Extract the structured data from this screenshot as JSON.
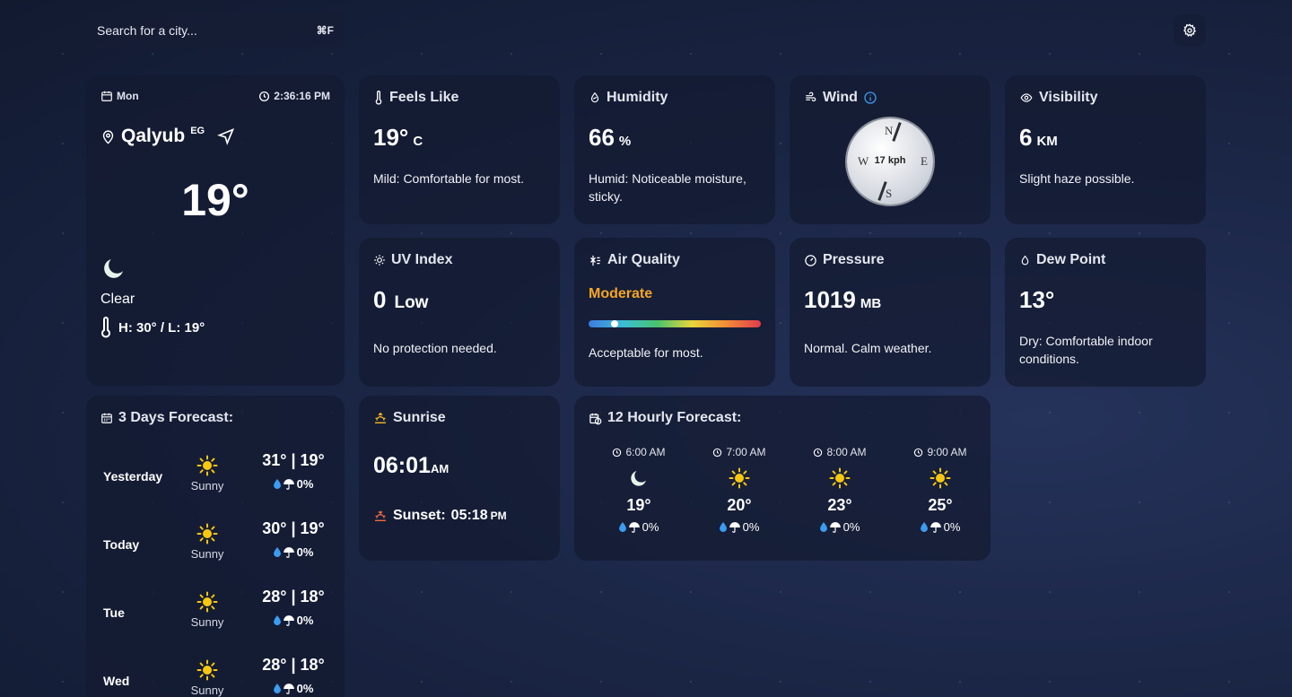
{
  "search": {
    "placeholder": "Search for a city...",
    "shortcut": "⌘F"
  },
  "main": {
    "day": "Mon",
    "time": "2:36:16 PM",
    "city": "Qalyub",
    "country": "EG",
    "temp": "19°",
    "condition": "Clear",
    "hilo": "H: 30° / L: 19°"
  },
  "feels": {
    "title": "Feels Like",
    "value": "19°",
    "unit": "C",
    "desc": "Mild: Comfortable for most."
  },
  "humidity": {
    "title": "Humidity",
    "value": "66",
    "unit": "%",
    "desc": "Humid: Noticeable moisture, sticky."
  },
  "wind": {
    "title": "Wind",
    "speed": "17 kph",
    "n": "N",
    "e": "E",
    "s": "S",
    "w": "W"
  },
  "visibility": {
    "title": "Visibility",
    "value": "6",
    "unit": "KM",
    "desc": "Slight haze possible."
  },
  "uv": {
    "title": "UV Index",
    "value": "0",
    "level": "Low",
    "desc": "No protection needed."
  },
  "air": {
    "title": "Air Quality",
    "level": "Moderate",
    "level_color": "#f5a623",
    "scale_position": 0.15,
    "desc": "Acceptable for most."
  },
  "pressure": {
    "title": "Pressure",
    "value": "1019",
    "unit": "MB",
    "desc": "Normal. Calm weather."
  },
  "dew": {
    "title": "Dew Point",
    "value": "13°",
    "desc": "Dry: Comfortable indoor conditions."
  },
  "forecast": {
    "title": "3 Days Forecast:",
    "days": [
      {
        "day": "Yesterday",
        "cond": "Sunny",
        "temps": "31° | 19°",
        "precip": "0%"
      },
      {
        "day": "Today",
        "cond": "Sunny",
        "temps": "30° | 19°",
        "precip": "0%"
      },
      {
        "day": "Tue",
        "cond": "Sunny",
        "temps": "28° | 18°",
        "precip": "0%"
      },
      {
        "day": "Wed",
        "cond": "Sunny",
        "temps": "28° | 18°",
        "precip": "0%"
      }
    ]
  },
  "sunrise": {
    "title": "Sunrise",
    "time": "06:01",
    "ampm": "AM",
    "sunset_label": "Sunset:",
    "sunset_time": "05:18",
    "sunset_ampm": "PM"
  },
  "hourly": {
    "title": "12 Hourly Forecast:",
    "hours": [
      {
        "time": "6:00 AM",
        "icon": "moon-icon",
        "temp": "19°",
        "precip": "0%"
      },
      {
        "time": "7:00 AM",
        "icon": "sun-icon",
        "temp": "20°",
        "precip": "0%"
      },
      {
        "time": "8:00 AM",
        "icon": "sun-icon",
        "temp": "23°",
        "precip": "0%"
      },
      {
        "time": "9:00 AM",
        "icon": "sun-icon",
        "temp": "25°",
        "precip": "0%"
      }
    ]
  }
}
